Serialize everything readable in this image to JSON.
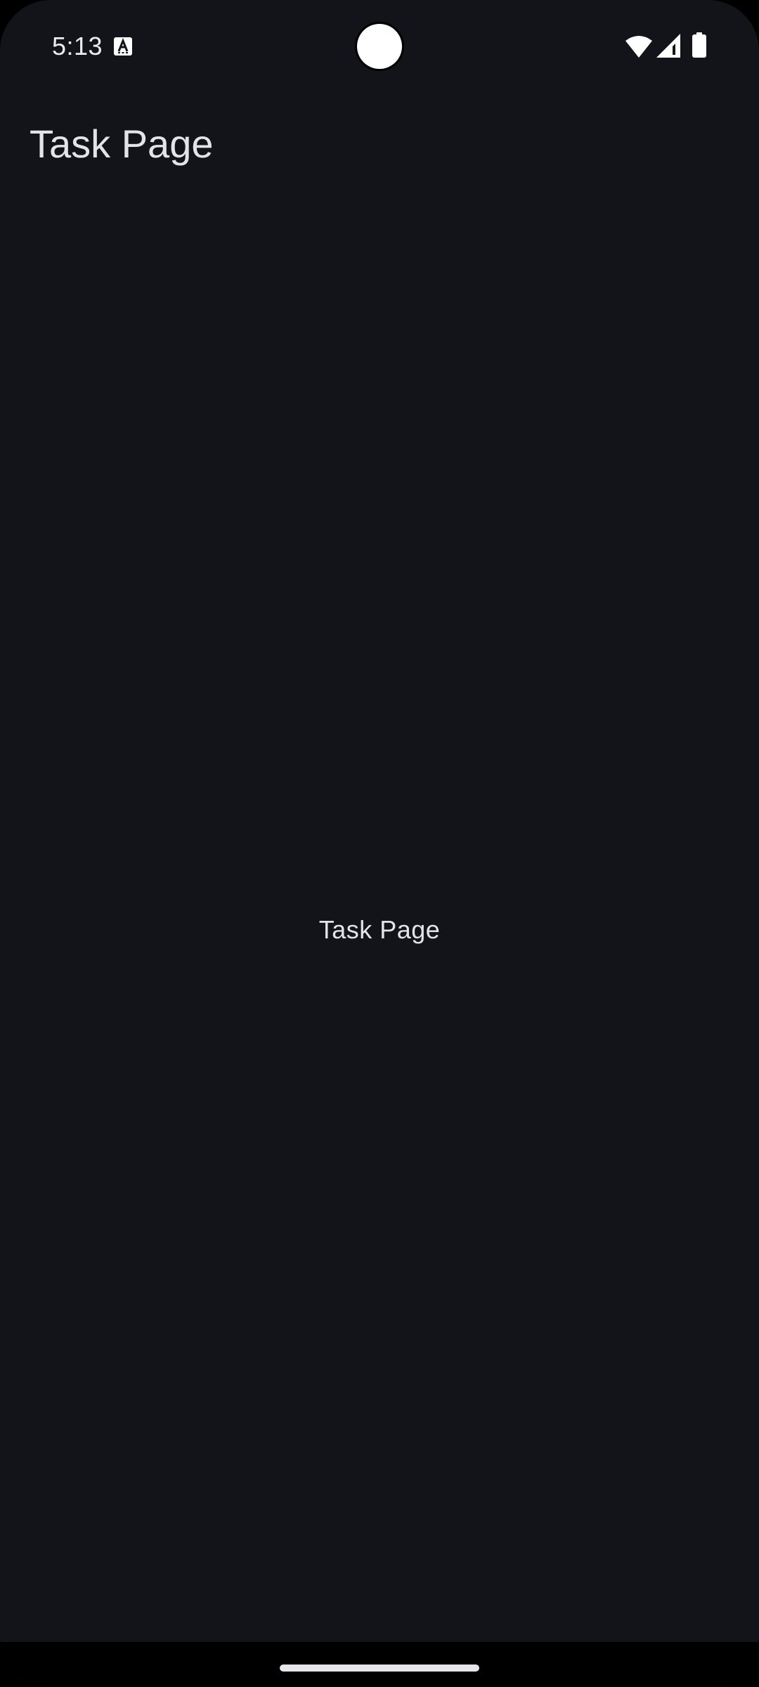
{
  "status_bar": {
    "time": "5:13",
    "icons": [
      "a-accessibility-icon",
      "wifi-icon",
      "signal-icon",
      "battery-icon"
    ]
  },
  "app_bar": {
    "title": "Task Page"
  },
  "content": {
    "text": "Task Page"
  },
  "colors": {
    "background": "#131419",
    "text": "#e3e3e8",
    "nav_bar": "#000000"
  }
}
